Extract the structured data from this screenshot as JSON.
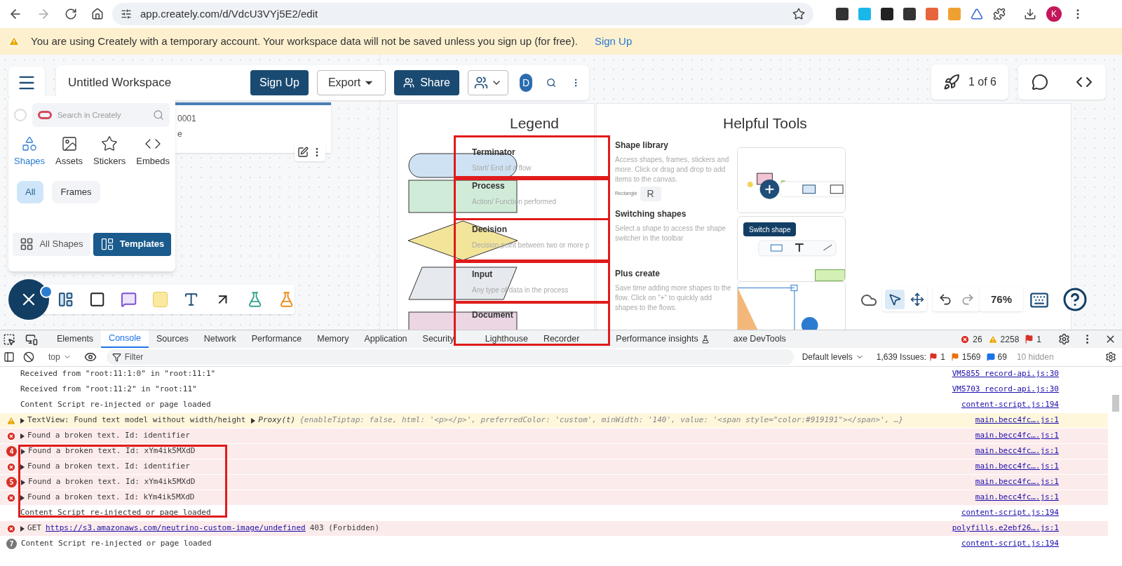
{
  "browser": {
    "url": "app.creately.com/d/VdcU3VYj5E2/edit",
    "profile_initial": "K"
  },
  "banner": {
    "message": "You are using Creately with a temporary account. Your workspace data will not be saved unless you sign up (for free).",
    "link": "Sign Up"
  },
  "workspace_bar": {
    "title": "Untitled Workspace",
    "sign_up": "Sign Up",
    "export": "Export",
    "share": "Share",
    "user_initial": "D"
  },
  "presentation": {
    "counter": "1 of 6"
  },
  "background_card": {
    "lines": [
      "0001",
      "e"
    ]
  },
  "shape_panel": {
    "search_placeholder": "Search in Creately",
    "tabs": [
      {
        "kind": "shapes",
        "label": "Shapes",
        "selected": true
      },
      {
        "kind": "assets",
        "label": "Assets",
        "selected": false
      },
      {
        "kind": "stickers",
        "label": "Stickers",
        "selected": false
      },
      {
        "kind": "embeds",
        "label": "Embeds",
        "selected": false
      }
    ],
    "filters": [
      {
        "label": "All",
        "selected": true
      },
      {
        "label": "Frames",
        "selected": false
      }
    ],
    "footer": [
      {
        "kind": "shapes",
        "label": "All Shapes",
        "selected": false
      },
      {
        "kind": "templates",
        "label": "Templates",
        "selected": true
      }
    ]
  },
  "legend": {
    "title": "Legend",
    "items": [
      {
        "kind": "terminator",
        "name": "Terminator",
        "description": "Start/ End of a flow"
      },
      {
        "kind": "process",
        "name": "Process",
        "description": "Action/ Function performed"
      },
      {
        "kind": "decision",
        "name": "Decision",
        "description": "Decision point between two or more p"
      },
      {
        "kind": "input",
        "name": "Input",
        "description": "Any type of data in the process"
      },
      {
        "kind": "document",
        "name": "Document"
      }
    ]
  },
  "helpful_tools": {
    "title": "Helpful Tools",
    "sections": [
      {
        "title": "Shape library",
        "description": "Access shapes, frames, stickers and more. Click or drag and drop to add items to the canvas.",
        "shortcut_label": "Rectangle",
        "shortcut_key": "R"
      },
      {
        "title": "Switching shapes",
        "description": "Select a shape to access the shape switcher in the toolbar"
      },
      {
        "title": "Plus create",
        "description": "Save time adding more shapes to the flow. Click on \"+\" to quickly add shapes to the flows."
      }
    ],
    "tooltip": "Switch shape"
  },
  "zoom": {
    "value": "76%"
  },
  "devtools": {
    "tabs": [
      {
        "label": "Elements",
        "selected": false
      },
      {
        "label": "Console",
        "selected": true
      },
      {
        "label": "Sources",
        "selected": false
      },
      {
        "label": "Network",
        "selected": false
      },
      {
        "label": "Performance",
        "selected": false
      },
      {
        "label": "Memory",
        "selected": false
      },
      {
        "label": "Application",
        "selected": false
      },
      {
        "label": "Security",
        "selected": false
      },
      {
        "label": "Lighthouse",
        "selected": false
      },
      {
        "label": "Recorder",
        "selected": false
      },
      {
        "label": "Performance insights",
        "selected": false
      },
      {
        "label": "axe DevTools",
        "selected": false
      }
    ],
    "error_count": "26",
    "warning_count": "2258",
    "issue_count": "1",
    "context": "top",
    "filter_placeholder": "Filter",
    "levels": "Default levels",
    "issues_label": "1,639 Issues:",
    "issues_errors": "1",
    "issues_warnings": "1569",
    "issues_info": "69",
    "hidden": "10 hidden",
    "messages": [
      {
        "kind": "info",
        "text": "Received from \"root:11:1:0\" in \"root:11:1\"",
        "source": "VM5855 record-api.js:30"
      },
      {
        "kind": "info",
        "text": "Received from \"root:11:2\" in \"root:11\"",
        "source": "VM5703 record-api.js:30"
      },
      {
        "kind": "info",
        "text": "Content Script re-injected or page loaded",
        "source": "content-script.js:194"
      },
      {
        "kind": "warning",
        "text": "TextView: Found text model without width/height",
        "details_label": "Proxy(t)",
        "details": "{enableTiptap: false, html: '<p></p>', preferredColor: 'custom', minWidth: '140', value: '<span style=\"color:#919191\"></span>', …}",
        "source": "main.becc4fc….js:1"
      },
      {
        "kind": "error",
        "text": "Found a broken text. Id: identifier",
        "source": "main.becc4fc….js:1"
      },
      {
        "kind": "error",
        "count": "4",
        "text": "Found a broken text. Id: xYm4ik5MXdD",
        "source": "main.becc4fc….js:1"
      },
      {
        "kind": "error",
        "text": "Found a broken text. Id: identifier",
        "source": "main.becc4fc….js:1"
      },
      {
        "kind": "error",
        "count": "5",
        "text": "Found a broken text. Id: xYm4ik5MXdD",
        "source": "main.becc4fc….js:1"
      },
      {
        "kind": "error",
        "text": "Found a broken text. Id: kYm4ik5MXdD",
        "source": "main.becc4fc….js:1"
      },
      {
        "kind": "info",
        "text": "Content Script re-injected or page loaded",
        "source": "content-script.js:194"
      },
      {
        "kind": "error",
        "text": "GET",
        "link": "https://s3.amazonaws.com/neutrino-custom-image/undefined",
        "suffix": "403 (Forbidden)",
        "source": "polyfills.e2ebf26….js:1"
      },
      {
        "kind": "info",
        "count": "7",
        "text": "Content Script re-injected or page loaded",
        "source": "content-script.js:194"
      }
    ]
  }
}
